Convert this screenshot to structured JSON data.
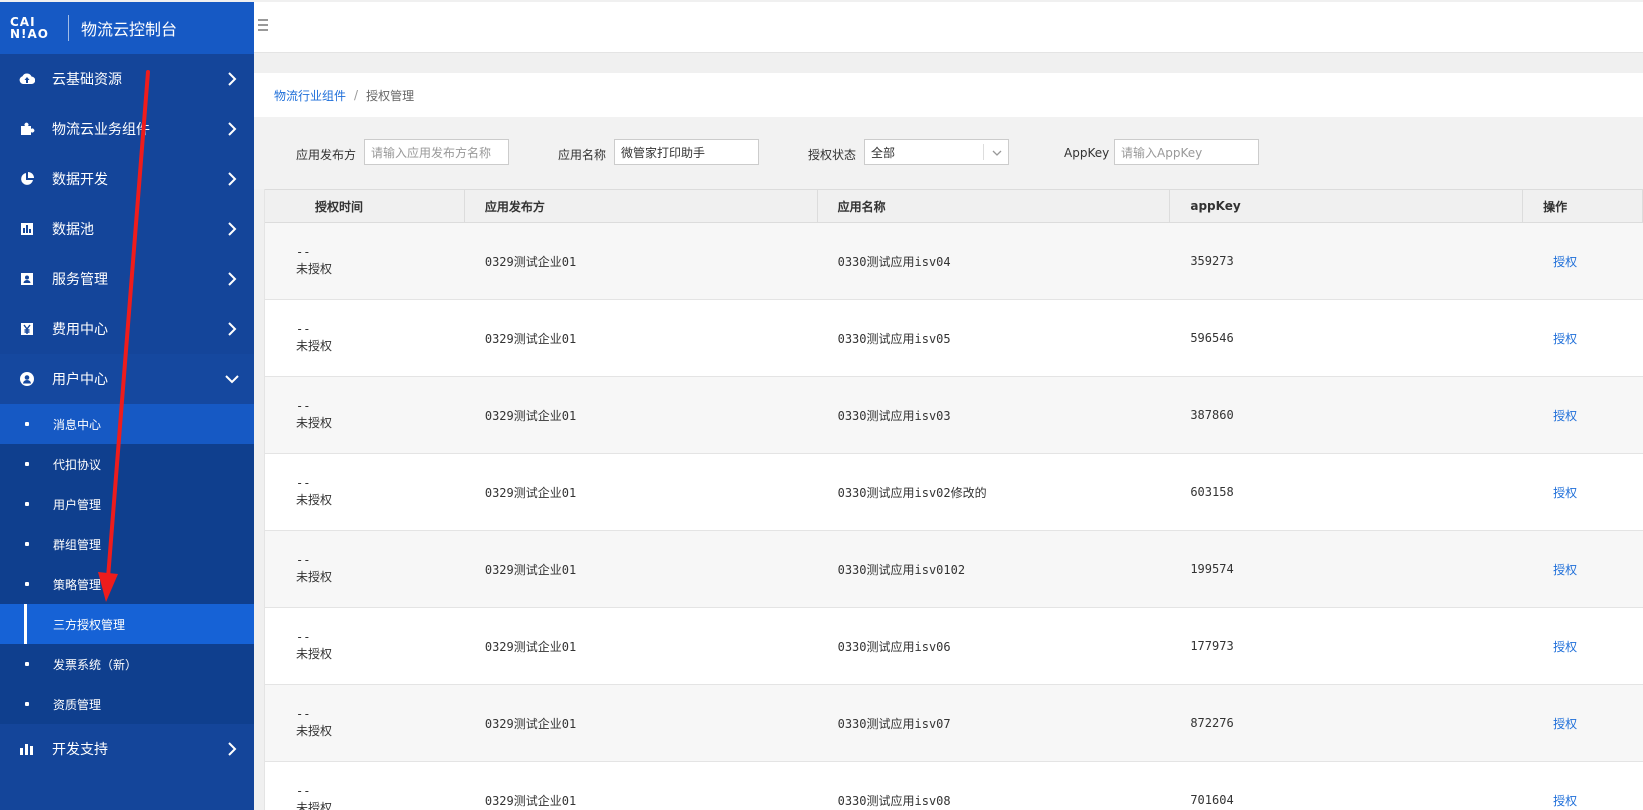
{
  "brand": {
    "logo_line1": "CAI",
    "logo_line2": "N!AO",
    "title": "物流云控制台"
  },
  "sidebar": {
    "items": [
      {
        "label": "云基础资源",
        "icon": "cloud-upload-icon"
      },
      {
        "label": "物流云业务组件",
        "icon": "puzzle-icon"
      },
      {
        "label": "数据开发",
        "icon": "pie-chart-icon"
      },
      {
        "label": "数据池",
        "icon": "bar-chart-icon"
      },
      {
        "label": "服务管理",
        "icon": "id-card-icon"
      },
      {
        "label": "费用中心",
        "icon": "yen-icon"
      },
      {
        "label": "用户中心",
        "icon": "user-circle-icon"
      },
      {
        "label": "开发支持",
        "icon": "bar-chart-icon"
      }
    ],
    "user_center_sub": [
      "消息中心",
      "代扣协议",
      "用户管理",
      "群组管理",
      "策略管理",
      "三方授权管理",
      "发票系统（新）",
      "资质管理"
    ]
  },
  "breadcrumb": {
    "parent": "物流行业组件",
    "separator": "/",
    "current": "授权管理"
  },
  "filters": {
    "publisher_label": "应用发布方",
    "publisher_placeholder": "请输入应用发布方名称",
    "appname_label": "应用名称",
    "appname_value": "微管家打印助手",
    "status_label": "授权状态",
    "status_value": "全部",
    "appkey_label": "AppKey",
    "appkey_placeholder": "请输入AppKey"
  },
  "table": {
    "headers": [
      "授权时间",
      "应用发布方",
      "应用名称",
      "appKey",
      "操作"
    ],
    "rows": [
      {
        "time": "--",
        "status": "未授权",
        "publisher": "0329测试企业01",
        "app": "0330测试应用isv04",
        "appkey": "359273",
        "action": "授权"
      },
      {
        "time": "--",
        "status": "未授权",
        "publisher": "0329测试企业01",
        "app": "0330测试应用isv05",
        "appkey": "596546",
        "action": "授权"
      },
      {
        "time": "--",
        "status": "未授权",
        "publisher": "0329测试企业01",
        "app": "0330测试应用isv03",
        "appkey": "387860",
        "action": "授权"
      },
      {
        "time": "--",
        "status": "未授权",
        "publisher": "0329测试企业01",
        "app": "0330测试应用isv02修改的",
        "appkey": "603158",
        "action": "授权"
      },
      {
        "time": "--",
        "status": "未授权",
        "publisher": "0329测试企业01",
        "app": "0330测试应用isv0102",
        "appkey": "199574",
        "action": "授权"
      },
      {
        "time": "--",
        "status": "未授权",
        "publisher": "0329测试企业01",
        "app": "0330测试应用isv06",
        "appkey": "177973",
        "action": "授权"
      },
      {
        "time": "--",
        "status": "未授权",
        "publisher": "0329测试企业01",
        "app": "0330测试应用isv07",
        "appkey": "872276",
        "action": "授权"
      },
      {
        "time": "--",
        "status": "未授权",
        "publisher": "0329测试企业01",
        "app": "0330测试应用isv08",
        "appkey": "701604",
        "action": "授权"
      }
    ]
  },
  "colors": {
    "sidebar": "#14459a",
    "brand": "#1659c4",
    "active": "#1662d6",
    "link": "#1f6fd9",
    "annotation_arrow": "#ee1c1c"
  }
}
